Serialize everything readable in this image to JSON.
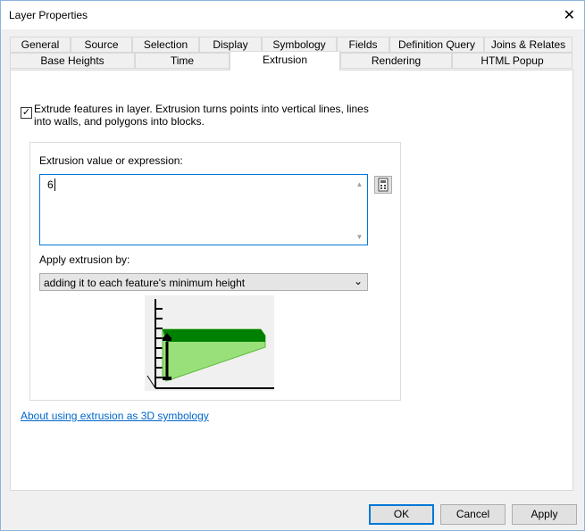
{
  "window": {
    "title": "Layer Properties",
    "close_icon": "close-icon"
  },
  "tabs_row1": [
    "General",
    "Source",
    "Selection",
    "Display",
    "Symbology",
    "Fields",
    "Definition Query",
    "Joins & Relates"
  ],
  "tabs_row2": [
    "Base Heights",
    "Time",
    "Extrusion",
    "Rendering",
    "HTML Popup"
  ],
  "active_tab": "Extrusion",
  "extrusion": {
    "extrude_checked": true,
    "extrude_label": "Extrude features in layer.  Extrusion turns points into vertical lines, lines into walls, and polygons into blocks.",
    "value_label": "Extrusion value or expression:",
    "value": "6",
    "apply_label": "Apply extrusion by:",
    "apply_selected": "adding it to each feature's minimum height",
    "link": "About using extrusion as 3D symbology",
    "colors": {
      "dark_green": "#008000",
      "light_green": "#99e07a"
    }
  },
  "buttons": {
    "ok": "OK",
    "cancel": "Cancel",
    "apply": "Apply"
  }
}
